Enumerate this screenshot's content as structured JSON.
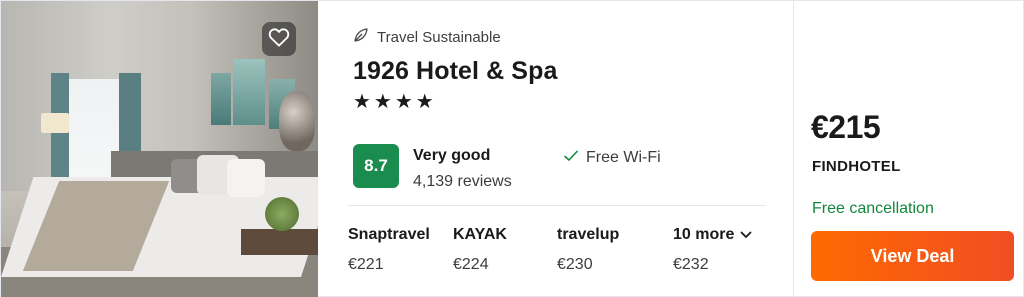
{
  "favorite": {
    "icon": "heart-outline-icon"
  },
  "hotel": {
    "sustainability_label": "Travel Sustainable",
    "sustainability_icon": "leaf-icon",
    "name": "1926 Hotel & Spa",
    "stars": "★★★★",
    "rating_score": "8.7",
    "rating_text": "Very good",
    "reviews": "4,139 reviews",
    "amenity_icon": "check-icon",
    "amenity": "Free Wi-Fi",
    "colors": {
      "rating_badge": "#1a8c4d",
      "cancel_text": "#12873b",
      "deal_button": "#ff6a00"
    }
  },
  "providers": [
    {
      "name": "Snaptravel",
      "price": "€221"
    },
    {
      "name": "KAYAK",
      "price": "€224"
    },
    {
      "name": "travelup",
      "price": "€230"
    },
    {
      "name": "10 more",
      "price": "€232",
      "icon": "chevron-down-icon"
    }
  ],
  "deal": {
    "price": "€215",
    "provider": "FINDHOTEL",
    "cancellation": "Free cancellation",
    "button_label": "View Deal"
  }
}
